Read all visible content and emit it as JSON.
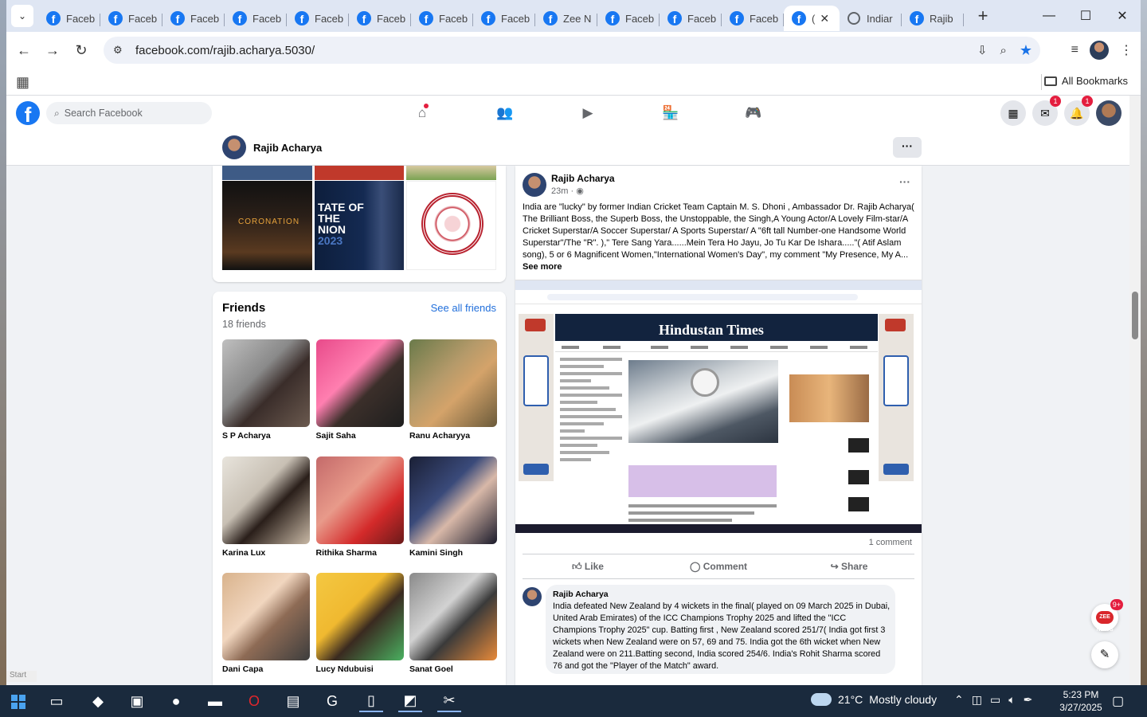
{
  "browser": {
    "tabs": [
      {
        "label": "Faceb",
        "icon": "facebook-icon",
        "active": false
      },
      {
        "label": "Faceb",
        "icon": "facebook-icon",
        "active": false
      },
      {
        "label": "Faceb",
        "icon": "facebook-icon",
        "active": false
      },
      {
        "label": "Faceb",
        "icon": "facebook-icon",
        "active": false
      },
      {
        "label": "Faceb",
        "icon": "facebook-icon",
        "active": false
      },
      {
        "label": "Faceb",
        "icon": "facebook-icon",
        "active": false
      },
      {
        "label": "Faceb",
        "icon": "facebook-icon",
        "active": false
      },
      {
        "label": "Faceb",
        "icon": "facebook-icon",
        "active": false
      },
      {
        "label": "Zee N",
        "icon": "facebook-icon",
        "active": false
      },
      {
        "label": "Faceb",
        "icon": "facebook-icon",
        "active": false
      },
      {
        "label": "Faceb",
        "icon": "facebook-icon",
        "active": false
      },
      {
        "label": "Faceb",
        "icon": "facebook-icon",
        "active": false
      },
      {
        "label": "(",
        "icon": "facebook-icon",
        "active": true
      },
      {
        "label": "Indiar",
        "icon": "globe-icon",
        "active": false
      },
      {
        "label": "Rajib",
        "icon": "facebook-icon",
        "active": false
      }
    ],
    "url": "facebook.com/rajib.acharya.5030/",
    "all_bookmarks": "All Bookmarks",
    "accent": "#1a73e8"
  },
  "facebook": {
    "search_placeholder": "Search Facebook",
    "messenger_badge": "1",
    "notifications_badge": "1",
    "brand_color": "#1877f2"
  },
  "profile": {
    "name": "Rajib Acharya",
    "more": "···"
  },
  "photos": {
    "tile1_caption": "CORONATION",
    "tile2_caption": "TATE OF THE NION",
    "tile2_year": "2023"
  },
  "friends": {
    "title": "Friends",
    "count": "18 friends",
    "see_all": "See all friends",
    "list": [
      {
        "name": "S P Acharya"
      },
      {
        "name": "Sajit Saha"
      },
      {
        "name": "Ranu Acharyya"
      },
      {
        "name": "Karina Lux"
      },
      {
        "name": "Rithika Sharma"
      },
      {
        "name": "Kamini Singh"
      },
      {
        "name": "Dani Capa"
      },
      {
        "name": "Lucy Ndubuisi"
      },
      {
        "name": "Sanat Goel"
      }
    ]
  },
  "post": {
    "author": "Rajib Acharya",
    "time": "23m ·",
    "more": "···",
    "text": "India are \"lucky\" by former Indian Cricket Team Captain M. S. Dhoni , Ambassador Dr. Rajib Acharya( The Brilliant Boss, the Superb Boss, the Unstoppable, the Singh,A Young Actor/A Lovely Film-star/A Cricket Superstar/A Soccer Superstar/ A Sports Superstar/ A \"6ft tall Number-one Handsome World Superstar\"/The \"R\". ),\" Tere Sang Yara......Mein Tera Ho Jayu, Jo Tu Kar De Ishara.....\"( Atif Aslam song), 5 or 6 Magnificent Women,\"International Women's Day\", my comment \"My Presence, My A...",
    "see_more": "See more",
    "shared_title": "Hindustan Times",
    "comments": "1 comment",
    "like": "Like",
    "comment": "Comment",
    "share": "Share"
  },
  "comment": {
    "author": "Rajib Acharya",
    "text": "India defeated New Zealand by 4 wickets in the final( played on 09 March 2025 in Dubai, United Arab Emirates) of the ICC Champions Trophy 2025 and lifted the \"ICC Champions Trophy 2025\" cup. Batting first , New Zealand scored 251/7( India got first 3 wickets when New Zealand were on 57, 69 and 75. India got the 6th wicket when New Zealand were on 211.Batting second, India scored 254/6. India's Rohit Sharma scored 76 and got the \"Player of the Match\" award."
  },
  "floating": {
    "chat_badge": "9+",
    "chat_label": "ZEE NEWS"
  },
  "taskbar": {
    "start_tip": "Start",
    "weather_temp": "21°C",
    "weather_desc": "Mostly cloudy",
    "time": "5:23 PM",
    "date": "3/27/2025"
  }
}
